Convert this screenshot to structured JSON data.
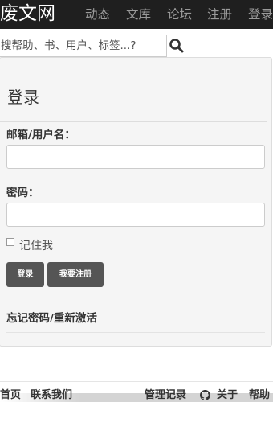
{
  "header": {
    "brand": "废文网",
    "nav": [
      "动态",
      "文库",
      "论坛",
      "注册",
      "登录"
    ]
  },
  "search": {
    "placeholder": "搜帮助、书、用户、标签...?",
    "icon": "search-icon"
  },
  "login": {
    "title": "登录",
    "email_label": "邮箱/用户名：",
    "password_label": "密码：",
    "remember_label": "记住我",
    "login_button": "登录",
    "register_button": "我要注册",
    "forgot_link": "忘记密码/重新激活"
  },
  "footer": {
    "home": "首页",
    "contact": "联系我们",
    "admin_log": "管理记录",
    "github_icon": "github-icon",
    "about": "关于",
    "help": "帮助"
  },
  "colors": {
    "topbar_bg": "#1f1f1f",
    "nav_text": "#9a9a9a",
    "button_bg": "#555555",
    "panel_bg": "#f5f5f5"
  }
}
